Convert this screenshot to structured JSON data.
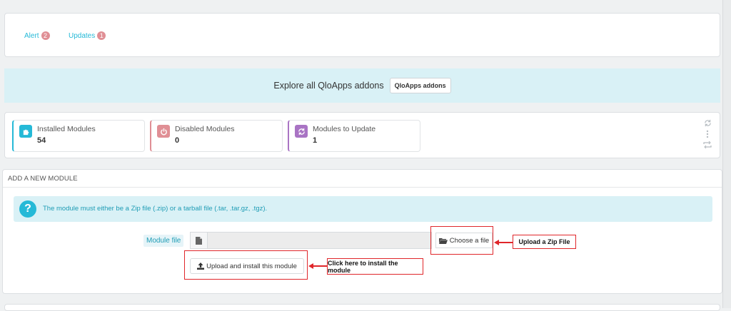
{
  "tabs": [
    {
      "label": "Alert",
      "count": "2"
    },
    {
      "label": "Updates",
      "count": "1"
    }
  ],
  "explore": {
    "text": "Explore all QloApps addons",
    "button_label": "QloApps addons"
  },
  "kpis": [
    {
      "label": "Installed Modules",
      "value": "54",
      "icon": "puzzle-icon",
      "color": "#25b9d7"
    },
    {
      "label": "Disabled Modules",
      "value": "0",
      "icon": "power-icon",
      "color": "#e08f95"
    },
    {
      "label": "Modules to Update",
      "value": "1",
      "icon": "refresh-icon",
      "color": "#a974c4"
    }
  ],
  "add_module": {
    "header": "ADD A NEW MODULE",
    "info": "The module must either be a Zip file (.zip) or a tarball file (.tar, .tar.gz, .tgz).",
    "file_label": "Module file",
    "file_value": "",
    "choose_label": "Choose a file",
    "upload_label": "Upload and install this module"
  },
  "annotations": {
    "zip_callout": "Upload a Zip File",
    "install_callout": "Click here to install the module"
  }
}
